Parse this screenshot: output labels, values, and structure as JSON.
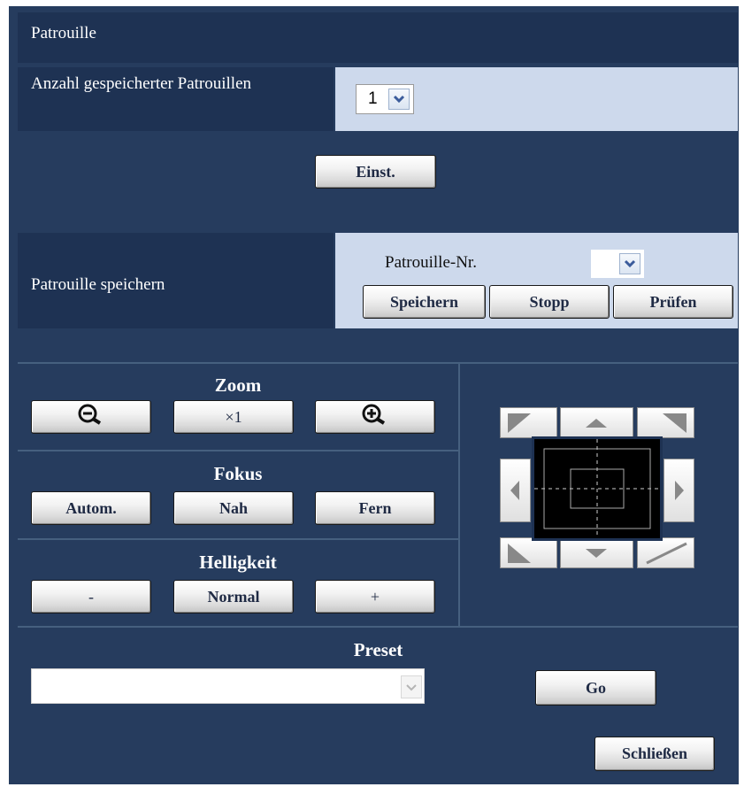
{
  "patrol": {
    "section_title": "Patrouille",
    "count_label": "Anzahl gespeicherter Patrouillen",
    "count_value": "1",
    "set_button": "Einst.",
    "save_label": "Patrouille speichern",
    "patrol_no_label": "Patrouille-Nr.",
    "patrol_no_value": "",
    "save_button": "Speichern",
    "stop_button": "Stopp",
    "check_button": "Prüfen"
  },
  "zoom": {
    "title": "Zoom",
    "reset_label": "×1",
    "zoom_out_icon": "zoom-out-magnifier",
    "zoom_in_icon": "zoom-in-magnifier"
  },
  "focus": {
    "title": "Fokus",
    "auto_label": "Autom.",
    "near_label": "Nah",
    "far_label": "Fern"
  },
  "brightness": {
    "title": "Helligkeit",
    "minus_label": "-",
    "normal_label": "Normal",
    "plus_label": "+"
  },
  "preset": {
    "title": "Preset",
    "value": "",
    "go_button": "Go"
  },
  "footer": {
    "close_button": "Schließen"
  },
  "colors": {
    "background": "#263c5e",
    "header": "#1e3253",
    "light_panel": "#cdd9ec"
  }
}
